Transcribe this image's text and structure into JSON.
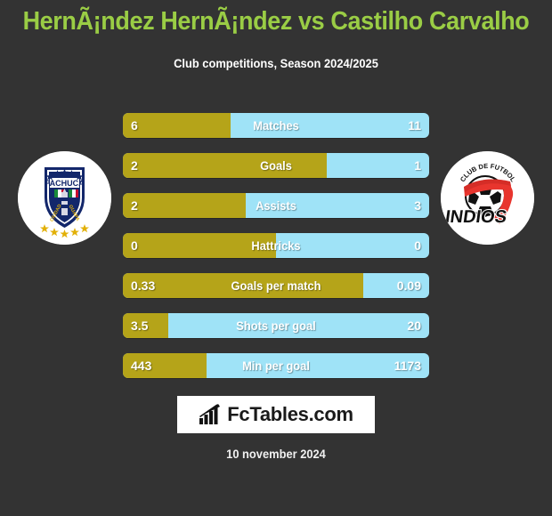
{
  "header": {
    "title": "HernÃ¡ndez HernÃ¡ndez vs Castilho Carvalho",
    "subtitle": "Club competitions, Season 2024/2025"
  },
  "teams": {
    "home": {
      "name": "PACHUCA",
      "badge_icon": "pachuca-crest-icon",
      "motto_left": "CIUDAD",
      "motto_right": "GUAPA"
    },
    "away": {
      "name": "INDIOS",
      "badge_icon": "indios-crest-icon",
      "arc_text": "CLUB DE FUTBOL"
    }
  },
  "footer": {
    "logo_text": "FcTables.com",
    "logo_icon": "bar-chart-arrow-icon",
    "date": "10 november 2024"
  },
  "colors": {
    "background": "#333333",
    "title": "#9ACD45",
    "home_bar": "#B5A419",
    "away_bar": "#9FE3F7",
    "text": "#ffffff"
  },
  "chart_data": {
    "type": "bar",
    "title": "HernÃ¡ndez HernÃ¡ndez vs Castilho Carvalho",
    "subtitle": "Club competitions, Season 2024/2025",
    "orientation": "horizontal-diverging",
    "legend": [
      "HernÃ¡ndez HernÃ¡ndez",
      "Castilho Carvalho"
    ],
    "categories": [
      "Matches",
      "Goals",
      "Assists",
      "Hattricks",
      "Goals per match",
      "Shots per goal",
      "Min per goal"
    ],
    "series": [
      {
        "name": "HernÃ¡ndez HernÃ¡ndez",
        "color": "#B5A419",
        "values": [
          6,
          2,
          2,
          0,
          0.33,
          3.5,
          443
        ]
      },
      {
        "name": "Castilho Carvalho",
        "color": "#9FE3F7",
        "values": [
          11,
          1,
          3,
          0,
          0.09,
          20,
          1173
        ]
      }
    ],
    "rows": [
      {
        "label": "Matches",
        "home": "6",
        "away": "11",
        "home_pct": 35.3
      },
      {
        "label": "Goals",
        "home": "2",
        "away": "1",
        "home_pct": 66.7
      },
      {
        "label": "Assists",
        "home": "2",
        "away": "3",
        "home_pct": 40.0
      },
      {
        "label": "Hattricks",
        "home": "0",
        "away": "0",
        "home_pct": 50.0
      },
      {
        "label": "Goals per match",
        "home": "0.33",
        "away": "0.09",
        "home_pct": 78.6
      },
      {
        "label": "Shots per goal",
        "home": "3.5",
        "away": "20",
        "home_pct": 14.9
      },
      {
        "label": "Min per goal",
        "home": "443",
        "away": "1173",
        "home_pct": 27.4
      }
    ]
  }
}
